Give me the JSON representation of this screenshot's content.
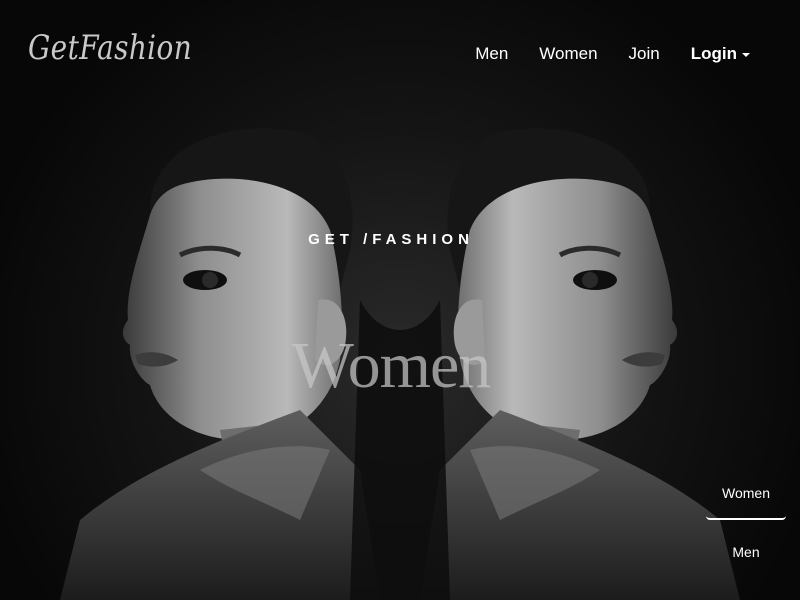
{
  "header": {
    "logo": "GetFashion",
    "nav": {
      "men": "Men",
      "women": "Women",
      "join": "Join",
      "login": "Login"
    }
  },
  "hero": {
    "kicker": "GET /FASHION",
    "title": "Women",
    "image_icon": "mirrored-portrait-image"
  },
  "side_tabs": {
    "active": "Women",
    "items": [
      "Women",
      "Men"
    ]
  },
  "colors": {
    "background": "#0c0c0c",
    "text": "#ffffff",
    "logo": "#c9c9c9",
    "title": "#c8c8c8"
  }
}
